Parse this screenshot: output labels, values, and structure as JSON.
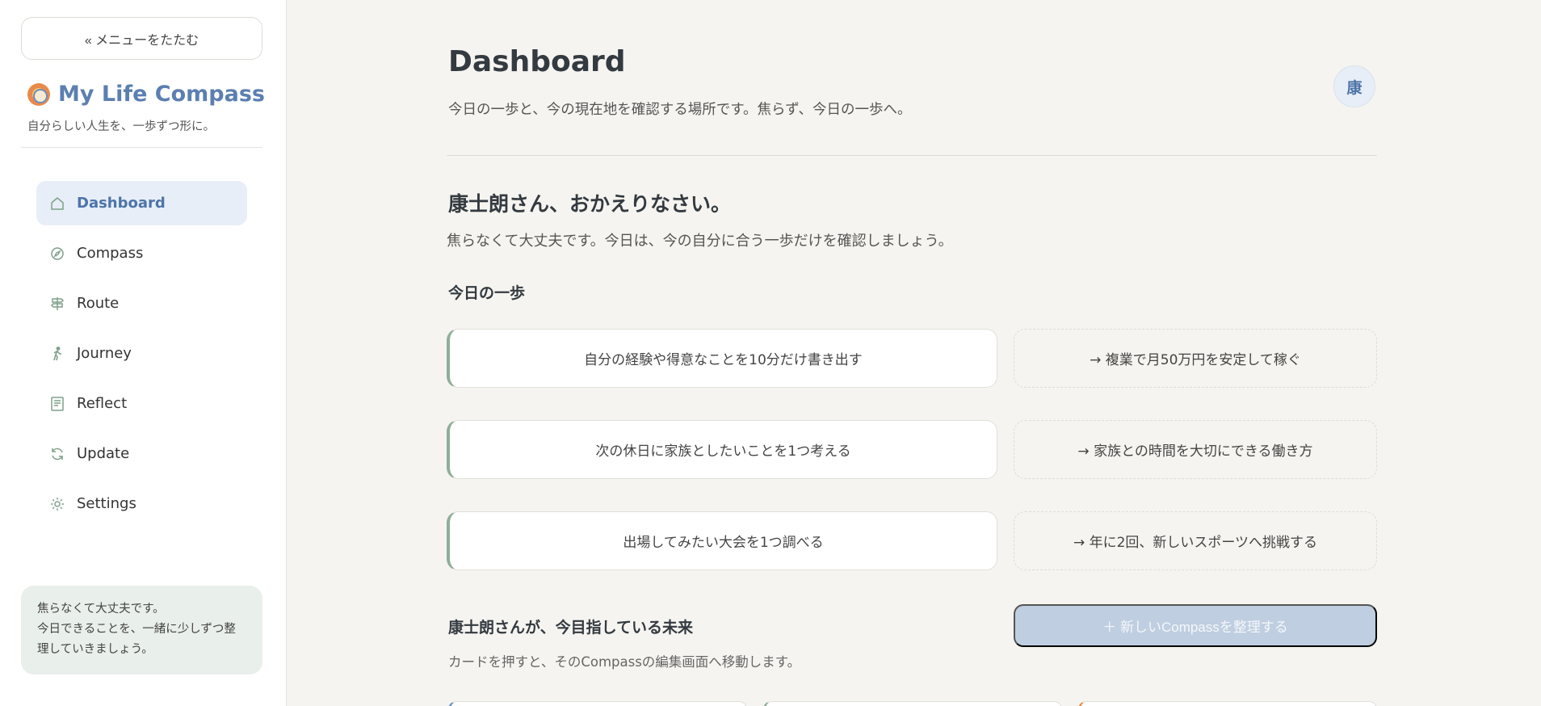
{
  "sidebar": {
    "collapse_label": "« メニューをたたむ",
    "brand_title": "My Life Compass",
    "brand_subtitle": "自分らしい人生を、一歩ずつ形に。",
    "items": [
      {
        "label": "Dashboard",
        "icon": "home-icon",
        "active": true
      },
      {
        "label": "Compass",
        "icon": "compass-icon",
        "active": false
      },
      {
        "label": "Route",
        "icon": "signpost-icon",
        "active": false
      },
      {
        "label": "Journey",
        "icon": "walking-icon",
        "active": false
      },
      {
        "label": "Reflect",
        "icon": "notebook-icon",
        "active": false
      },
      {
        "label": "Update",
        "icon": "refresh-icon",
        "active": false
      },
      {
        "label": "Settings",
        "icon": "gear-icon",
        "active": false
      }
    ],
    "note_line1": "焦らなくて大丈夫です。",
    "note_line2": "今日できることを、一緒に少しずつ整理していきましょう。"
  },
  "header": {
    "title": "Dashboard",
    "subtitle": "今日の一歩と、今の現在地を確認する場所です。焦らず、今日の一歩へ。",
    "avatar_initial": "康"
  },
  "welcome": {
    "title": "康士朗さん、おかえりなさい。",
    "subtitle": "焦らなくて大丈夫です。今日は、今の自分に合う一歩だけを確認しましょう。"
  },
  "today_steps": {
    "title": "今日の一歩",
    "items": [
      {
        "step": "自分の経験や得意なことを10分だけ書き出す",
        "goal": "→ 複業で月50万円を安定して稼ぐ"
      },
      {
        "step": "次の休日に家族としたいことを1つ考える",
        "goal": "→ 家族との時間を大切にできる働き方"
      },
      {
        "step": "出場してみたい大会を1つ調べる",
        "goal": "→ 年に2回、新しいスポーツへ挑戦する"
      }
    ]
  },
  "future": {
    "title": "康士朗さんが、今目指している未来",
    "subtitle": "カードを押すと、そのCompassの編集画面へ移動します。",
    "new_button": "＋ 新しいCompassを整理する"
  },
  "colors": {
    "accent": "#5b7fb0",
    "active_bg": "#e7eef7",
    "step_border": "#8fae97",
    "note_bg": "#e9efea",
    "page_bg": "#f5f4f0"
  }
}
